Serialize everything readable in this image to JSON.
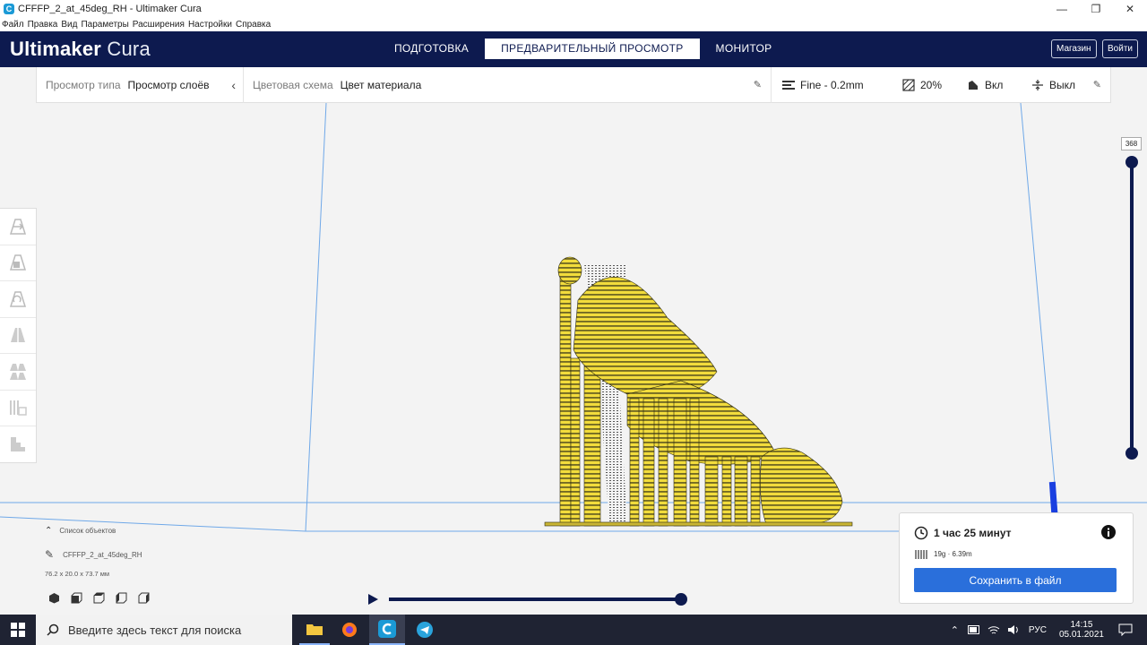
{
  "window": {
    "title": "CFFFP_2_at_45deg_RH - Ultimaker Cura",
    "minimize": "—",
    "maximize": "❐",
    "close": "✕"
  },
  "menu": [
    "Файл",
    "Правка",
    "Вид",
    "Параметры",
    "Расширения",
    "Настройки",
    "Справка"
  ],
  "header": {
    "logo_bold": "Ultimaker",
    "logo_light": "Cura",
    "tabs": [
      "ПОДГОТОВКА",
      "ПРЕДВАРИТЕЛЬНЫЙ ПРОСМОТР",
      "МОНИТОР"
    ],
    "active_tab": 1,
    "store_label": "Магазин",
    "signin_label": "Войти"
  },
  "viewbar": {
    "view_type_label": "Просмотр типа",
    "view_type_value": "Просмотр слоёв",
    "color_scheme_label": "Цветовая схема",
    "color_scheme_value": "Цвет материала",
    "profile": "Fine - 0.2mm",
    "infill": "20%",
    "support": "Вкл",
    "adhesion": "Выкл"
  },
  "layer_slider": {
    "max_layer": "368"
  },
  "object_list": {
    "title": "Список объектов",
    "object_name": "CFFFP_2_at_45deg_RH",
    "dimensions": "76.2 x 20.0 x 73.7 мм"
  },
  "print_info": {
    "time": "1 час 25 минут",
    "material": "19g · 6.39m",
    "save_label": "Сохранить в файл"
  },
  "taskbar": {
    "search_placeholder": "Введите здесь текст для поиска",
    "lang": "РУС",
    "time": "14:15",
    "date": "05.01.2021"
  },
  "colors": {
    "header": "#0d1a4f",
    "accent": "#2a6fdb",
    "model": "#f3dc3a"
  }
}
